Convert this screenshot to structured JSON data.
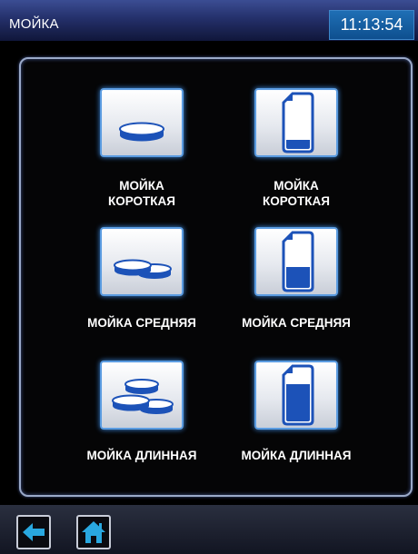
{
  "header": {
    "title": "МОЙКА",
    "clock": "11:13:54"
  },
  "programs": [
    {
      "label_line1": "МОЙКА",
      "label_line2": "КОРОТКАЯ",
      "icon": "single-tablet-icon"
    },
    {
      "label_line1": "МОЙКА",
      "label_line2": "КОРОТКАЯ",
      "icon": "detergent-canister-low-icon"
    },
    {
      "label": "МОЙКА СРЕДНЯЯ",
      "icon": "two-tablets-icon"
    },
    {
      "label": "МОЙКА СРЕДНЯЯ",
      "icon": "detergent-canister-medium-icon"
    },
    {
      "label": "МОЙКА ДЛИННАЯ",
      "icon": "three-tablets-icon"
    },
    {
      "label": "МОЙКА ДЛИННАЯ",
      "icon": "detergent-canister-full-icon"
    }
  ],
  "footer": {
    "back_icon": "back-arrow-icon",
    "home_icon": "home-icon"
  },
  "colors": {
    "accent": "#2f6fd6",
    "icon_fill": "#1c52b8",
    "clock_bg": "#0e4f8f"
  }
}
